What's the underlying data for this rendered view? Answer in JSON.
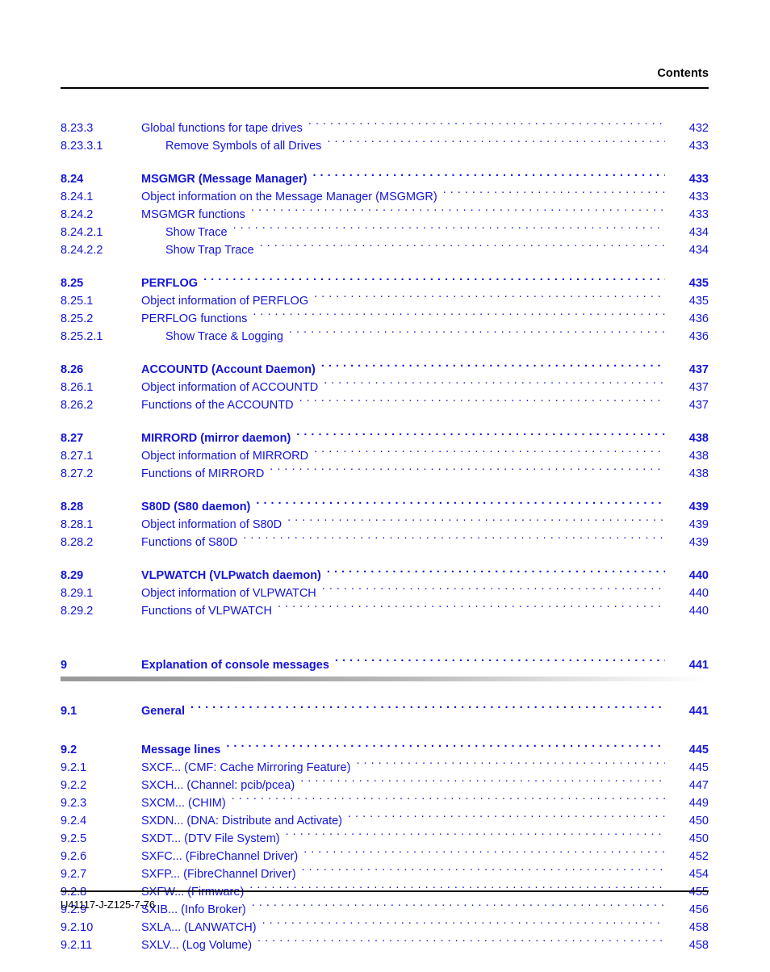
{
  "header": {
    "title": "Contents"
  },
  "footer": {
    "doc_id": "U41117-J-Z125-7-76"
  },
  "colors": {
    "entry_blue": "#1414dc",
    "header_black": "#000000",
    "chapter_bar_start": "#9a9a9a",
    "chapter_bar_end": "#ffffff"
  },
  "toc": {
    "entries": [
      {
        "num": "8.23.3",
        "title": "Global functions for tape drives",
        "page": "432",
        "level": 3,
        "gap": "none"
      },
      {
        "num": "8.23.3.1",
        "title": "Remove Symbols of all Drives",
        "page": "433",
        "level": 4,
        "gap": "none"
      },
      {
        "num": "8.24",
        "title": "MSGMGR (Message Manager)",
        "page": "433",
        "level": 2,
        "gap": "before"
      },
      {
        "num": "8.24.1",
        "title": "Object information on the Message Manager (MSGMGR)",
        "page": "433",
        "level": 3,
        "gap": "none"
      },
      {
        "num": "8.24.2",
        "title": "MSGMGR functions",
        "page": "433",
        "level": 3,
        "gap": "none"
      },
      {
        "num": "8.24.2.1",
        "title": "Show Trace",
        "page": "434",
        "level": 4,
        "gap": "none"
      },
      {
        "num": "8.24.2.2",
        "title": "Show Trap Trace",
        "page": "434",
        "level": 4,
        "gap": "none"
      },
      {
        "num": "8.25",
        "title": "PERFLOG",
        "page": "435",
        "level": 2,
        "gap": "before"
      },
      {
        "num": "8.25.1",
        "title": "Object information of PERFLOG",
        "page": "435",
        "level": 3,
        "gap": "none"
      },
      {
        "num": "8.25.2",
        "title": "PERFLOG functions",
        "page": "436",
        "level": 3,
        "gap": "none"
      },
      {
        "num": "8.25.2.1",
        "title": "Show Trace & Logging",
        "page": "436",
        "level": 4,
        "gap": "none"
      },
      {
        "num": "8.26",
        "title": "ACCOUNTD (Account Daemon)",
        "page": "437",
        "level": 2,
        "gap": "before"
      },
      {
        "num": "8.26.1",
        "title": "Object information of ACCOUNTD",
        "page": "437",
        "level": 3,
        "gap": "none"
      },
      {
        "num": "8.26.2",
        "title": "Functions of the ACCOUNTD",
        "page": "437",
        "level": 3,
        "gap": "none"
      },
      {
        "num": "8.27",
        "title": "MIRRORD (mirror daemon)",
        "page": "438",
        "level": 2,
        "gap": "before"
      },
      {
        "num": "8.27.1",
        "title": "Object information of MIRRORD",
        "page": "438",
        "level": 3,
        "gap": "none"
      },
      {
        "num": "8.27.2",
        "title": "Functions of MIRRORD",
        "page": "438",
        "level": 3,
        "gap": "none"
      },
      {
        "num": "8.28",
        "title": "S80D (S80 daemon)",
        "page": "439",
        "level": 2,
        "gap": "before"
      },
      {
        "num": "8.28.1",
        "title": "Object information of S80D",
        "page": "439",
        "level": 3,
        "gap": "none"
      },
      {
        "num": "8.28.2",
        "title": "Functions of  S80D",
        "page": "439",
        "level": 3,
        "gap": "none"
      },
      {
        "num": "8.29",
        "title": "VLPWATCH (VLPwatch daemon)",
        "page": "440",
        "level": 2,
        "gap": "before"
      },
      {
        "num": "8.29.1",
        "title": "Object information of VLPWATCH",
        "page": "440",
        "level": 3,
        "gap": "none"
      },
      {
        "num": "8.29.2",
        "title": "Functions of  VLPWATCH",
        "page": "440",
        "level": 3,
        "gap": "none"
      },
      {
        "num": "9",
        "title": "Explanation of console messages",
        "page": "441",
        "level": 1,
        "gap": "chapter",
        "bar": true
      },
      {
        "num": "9.1",
        "title": "General",
        "page": "441",
        "level": 2,
        "gap": "section"
      },
      {
        "num": "9.2",
        "title": "Message lines",
        "page": "445",
        "level": 2,
        "gap": "section"
      },
      {
        "num": "9.2.1",
        "title": "SXCF... (CMF: Cache Mirroring Feature)",
        "page": "445",
        "level": 3,
        "gap": "none"
      },
      {
        "num": "9.2.2",
        "title": "SXCH... (Channel: pcib/pcea)",
        "page": "447",
        "level": 3,
        "gap": "none"
      },
      {
        "num": "9.2.3",
        "title": "SXCM... (CHIM)",
        "page": "449",
        "level": 3,
        "gap": "none"
      },
      {
        "num": "9.2.4",
        "title": "SXDN... (DNA: Distribute and Activate)",
        "page": "450",
        "level": 3,
        "gap": "none"
      },
      {
        "num": "9.2.5",
        "title": "SXDT... (DTV File System)",
        "page": "450",
        "level": 3,
        "gap": "none"
      },
      {
        "num": "9.2.6",
        "title": "SXFC... (FibreChannel Driver)",
        "page": "452",
        "level": 3,
        "gap": "none"
      },
      {
        "num": "9.2.7",
        "title": "SXFP... (FibreChannel Driver)",
        "page": "454",
        "level": 3,
        "gap": "none"
      },
      {
        "num": "9.2.8",
        "title": "SXFW... (Firmware)",
        "page": "455",
        "level": 3,
        "gap": "none"
      },
      {
        "num": "9.2.9",
        "title": "SXIB... (Info Broker)",
        "page": "456",
        "level": 3,
        "gap": "none"
      },
      {
        "num": "9.2.10",
        "title": "SXLA... (LANWATCH)",
        "page": "458",
        "level": 3,
        "gap": "none"
      },
      {
        "num": "9.2.11",
        "title": "SXLV... (Log Volume)",
        "page": "458",
        "level": 3,
        "gap": "none"
      }
    ]
  }
}
